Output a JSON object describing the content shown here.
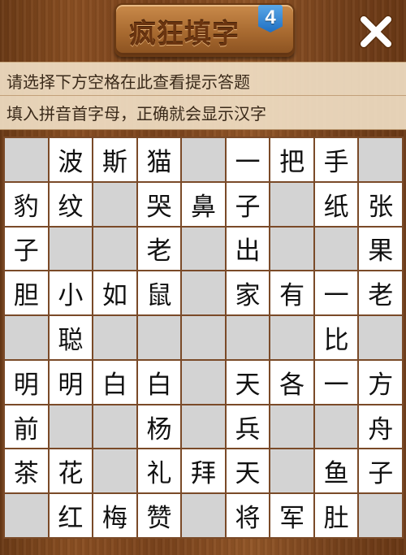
{
  "header": {
    "title": "疯狂填字",
    "level": "4",
    "close_icon": "close-icon"
  },
  "hints": {
    "line1": "请选择下方空格在此查看提示答题",
    "line2": "填入拼音首字母，正确就会显示汉字"
  },
  "colors": {
    "blank_cell": "#d3d3d3",
    "filled_cell": "#ffffff",
    "grid_line": "#7a4a28",
    "level_badge": "#2f83d6"
  },
  "grid": [
    [
      "",
      "波",
      "斯",
      "猫",
      "",
      "一",
      "把",
      "手",
      ""
    ],
    [
      "豹",
      "纹",
      "",
      "哭",
      "鼻",
      "子",
      "",
      "纸",
      "张"
    ],
    [
      "子",
      "",
      "",
      "老",
      "",
      "出",
      "",
      "",
      "果"
    ],
    [
      "胆",
      "小",
      "如",
      "鼠",
      "",
      "家",
      "有",
      "一",
      "老"
    ],
    [
      "",
      "聪",
      "",
      "",
      "",
      "",
      "",
      "比",
      ""
    ],
    [
      "明",
      "明",
      "白",
      "白",
      "",
      "天",
      "各",
      "一",
      "方"
    ],
    [
      "前",
      "",
      "",
      "杨",
      "",
      "兵",
      "",
      "",
      "舟"
    ],
    [
      "茶",
      "花",
      "",
      "礼",
      "拜",
      "天",
      "",
      "鱼",
      "子"
    ],
    [
      "",
      "红",
      "梅",
      "赞",
      "",
      "将",
      "军",
      "肚",
      ""
    ]
  ]
}
